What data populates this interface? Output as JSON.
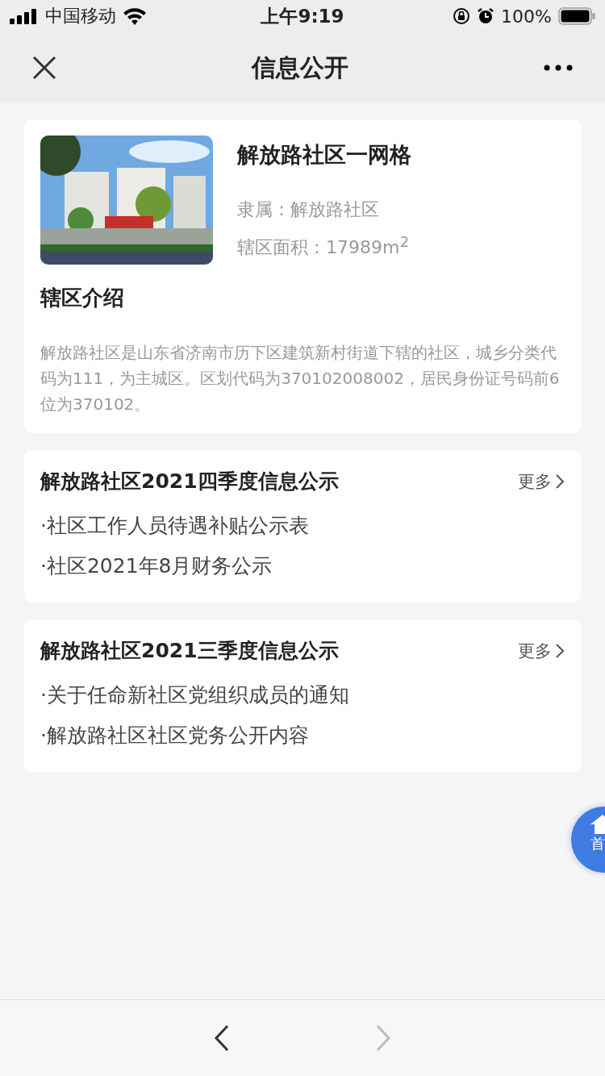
{
  "status_bar": {
    "carrier": "中国移动",
    "time": "上午9:19",
    "battery": "100%"
  },
  "nav": {
    "title": "信息公开"
  },
  "profile": {
    "name": "解放路社区一网格",
    "affiliation": "隶属：解放路社区",
    "area": "辖区面积：17989m$^{2}$",
    "intro_title": "辖区介绍",
    "intro": "解放路社区是山东省济南市历下区建筑新村街道下辖的社区，城乡分类代码为111，为主城区。区划代码为370102008002，居民身份证号码前6位为370102。"
  },
  "sections": [
    {
      "title": "解放路社区2021四季度信息公示",
      "more": "更多",
      "items": [
        "·社区工作人员待遇补贴公示表",
        "·社区2021年8月财务公示"
      ]
    },
    {
      "title": "解放路社区2021三季度信息公示",
      "more": "更多",
      "items": [
        "·关于任命新社区党组织成员的通知",
        "·解放路社区社区党务公开内容"
      ]
    }
  ],
  "float_button": {
    "label": "首"
  },
  "toolbar": {
    "back_disabled": false,
    "forward_disabled": true
  }
}
